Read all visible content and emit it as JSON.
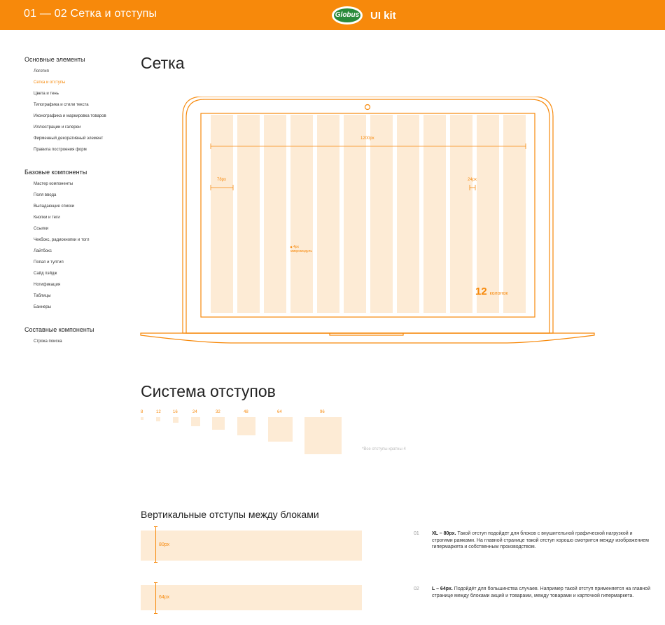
{
  "header": {
    "title": "01 — 02 Сетка и отступы",
    "logo_text": "Globus",
    "kit_label": "UI kit"
  },
  "sidebar": {
    "groups": [
      {
        "title": "Основные элементы",
        "items": [
          "Логотип",
          "Сетка и отступы",
          "Цвета и тень",
          "Типографика и стили текста",
          "Иконографика и маркировка товаров",
          "Иллюстрации и галереи",
          "Фирменный декоративный элемент",
          "Правила построения форм"
        ]
      },
      {
        "title": "Базовые компоненты",
        "items": [
          "Мастер компоненты",
          "Поля ввода",
          "Выпадающие списки",
          "Кнопки и теги",
          "Ссылки",
          "Чекбокс, радиокнопки и тогл",
          "Лайтбокс",
          "Попап и тултип",
          "Сайд пэйдж",
          "Нотификация",
          "Таблицы",
          "Баннеры"
        ]
      },
      {
        "title": "Составные компоненты",
        "items": [
          "Строка поиска"
        ]
      }
    ],
    "active_item": "Сетка и отступы"
  },
  "grid_section": {
    "title": "Сетка",
    "width_label": "1200px",
    "column_label": "78px",
    "gutter_label": "24px",
    "micro_label_1": "4px",
    "micro_label_2": "микромодуль",
    "columns_count": "12",
    "columns_word": "колонок"
  },
  "spacing_section": {
    "title": "Система отступов",
    "sizes": [
      "8",
      "12",
      "16",
      "24",
      "32",
      "48",
      "64",
      "96"
    ],
    "note": "*Все отступы кратны 4"
  },
  "vertical_section": {
    "title": "Вертикальные отступы между блоками",
    "blocks": [
      {
        "label": "80px",
        "num": "01",
        "bold": "XL – 80px.",
        "text": " Такой отступ подойдет для блоков с внушительной графической нагрузкой и строгими рамками. На главной странице такой отступ хорошо смотрится между изображением гипермаркета и собственным производством."
      },
      {
        "label": "64px",
        "num": "02",
        "bold": "L – 64px.",
        "text": " Подойдёт для большинства случаев. Например такой отступ применяется на главной странице между блоками акций и товарами, между товарами и карточкой гипермаркета."
      }
    ]
  },
  "colors": {
    "accent": "#F7890B",
    "tint": "#FDEBD5"
  }
}
